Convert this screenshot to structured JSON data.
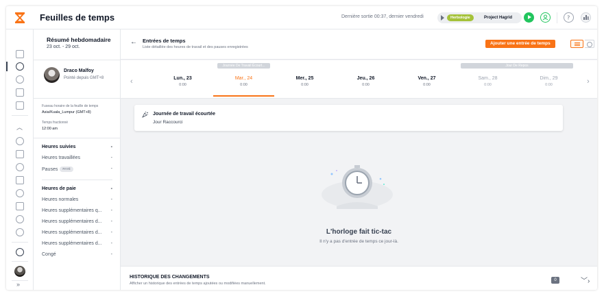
{
  "app": {
    "page_title": "Feuilles de temps",
    "last_out": "Dernière sortie 00:37, dernier vendredi",
    "timer": {
      "tag": "Herbologie",
      "project": "Project Hagrid"
    },
    "colors": {
      "accent": "#f97316",
      "success": "#22c55e",
      "tag": "#a5c23a"
    }
  },
  "weekly": {
    "title": "Résumé hebdomadaire",
    "range": "23 oct. - 29 oct."
  },
  "user": {
    "name": "Draco Malfoy",
    "status": "Pointé depuis GMT+8"
  },
  "meta": {
    "tz_label": "Fuseau horaire de la feuille de temps",
    "tz_value": "Asia/Kuala_Lumpur (GMT+8)",
    "split_label": "Temps fractionné",
    "split_value": "12:00 am"
  },
  "tracked": {
    "title": "Heures suivies",
    "title_value": "-",
    "rows": [
      {
        "label": "Heures travaillées",
        "value": "-"
      },
      {
        "label": "Pauses",
        "badge": "PAYÉ",
        "value": "-"
      }
    ]
  },
  "payroll": {
    "title": "Heures de paie",
    "title_value": "-",
    "rows": [
      {
        "label": "Heures normales",
        "value": "-"
      },
      {
        "label": "Heures supplémentaires q...",
        "value": "-"
      },
      {
        "label": "Heures supplémentaires d...",
        "value": "-"
      },
      {
        "label": "Heures supplémentaires d...",
        "value": "-"
      },
      {
        "label": "Heures supplémentaires d...",
        "value": "-"
      },
      {
        "label": "Congé",
        "value": "-"
      }
    ]
  },
  "main": {
    "title": "Entrées de temps",
    "subtitle": "Liste détaillée des heures de travail et des pauses enregistrées",
    "add_button": "Ajouter une entrée de temps"
  },
  "days": {
    "banner_short": "Journée De Travail Écourt...",
    "banner_rest": "Jour De Repos",
    "items": [
      {
        "name": "Lun., 23",
        "time": "0:00"
      },
      {
        "name": "Mar., 24",
        "time": "0:00"
      },
      {
        "name": "Mer., 25",
        "time": "0:00"
      },
      {
        "name": "Jeu., 26",
        "time": "0:00"
      },
      {
        "name": "Ven., 27",
        "time": "0:00"
      },
      {
        "name": "Sam., 28",
        "time": "0:00"
      },
      {
        "name": "Dim., 29",
        "time": "0:00"
      }
    ]
  },
  "day_card": {
    "title": "Journée de travail écourtée",
    "subtitle": "Jour Raccourci"
  },
  "empty": {
    "title": "L'horloge fait tic-tac",
    "subtitle": "Il n'y a pas d'entrée de temps ce jour-là."
  },
  "history": {
    "title": "HISTORIQUE DES CHANGEMENTS",
    "subtitle": "Afficher un historique des entrées de temps ajoutées ou modifiées manuellement.",
    "count": "0"
  }
}
